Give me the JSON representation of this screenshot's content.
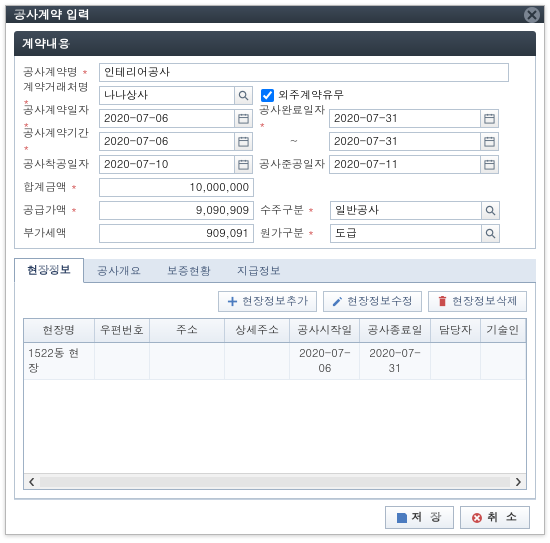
{
  "title": "공사계약 입력",
  "section_header": "계약내용",
  "labels": {
    "contract_name": "공사계약명",
    "partner": "계약거래처명",
    "outsource": "외주계약유무",
    "contract_date": "공사계약일자",
    "end_date": "공사완료일자",
    "period": "공사계약기간",
    "start_work": "공사착공일자",
    "finish_work": "공사준공일자",
    "total_amount": "합계금액",
    "supply_amount": "공급가액",
    "order_type": "수주구분",
    "vat": "부가세액",
    "cost_type": "원가구분"
  },
  "values": {
    "contract_name": "인테리어공사",
    "partner": "나나상사",
    "outsource_checked": true,
    "contract_date": "2020-07-06",
    "end_date": "2020-07-31",
    "period_from": "2020-07-06",
    "period_to": "2020-07-31",
    "start_work": "2020-07-10",
    "finish_work": "2020-07-11",
    "total_amount": "10,000,000",
    "supply_amount": "9,090,909",
    "order_type": "일반공사",
    "vat": "909,091",
    "cost_type": "도급",
    "tilde": "~"
  },
  "tabs": [
    "현장정보",
    "공사개요",
    "보증현황",
    "지급정보"
  ],
  "active_tab": 0,
  "toolbar": {
    "add": "현장정보추가",
    "edit": "현장정보수정",
    "delete": "현장정보삭제"
  },
  "grid": {
    "columns": [
      "현장명",
      "우편번호",
      "주소",
      "상세주소",
      "공사시작일",
      "공사종료일",
      "담당자",
      "기술인"
    ],
    "rows": [
      {
        "site": "1522동 현장",
        "zip": "",
        "addr": "",
        "detail": "",
        "start": "2020-07-06",
        "end": "2020-07-31",
        "manager": "",
        "tech": ""
      }
    ]
  },
  "footer": {
    "save": "저 장",
    "cancel": "취 소"
  }
}
